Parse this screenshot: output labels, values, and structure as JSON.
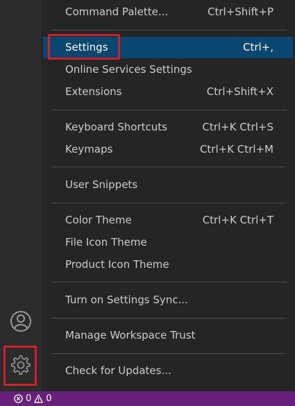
{
  "menu": {
    "items": [
      {
        "label": "Command Palette...",
        "shortcut": "Ctrl+Shift+P"
      },
      {
        "label": "Settings",
        "shortcut": "Ctrl+,"
      },
      {
        "label": "Online Services Settings",
        "shortcut": ""
      },
      {
        "label": "Extensions",
        "shortcut": "Ctrl+Shift+X"
      },
      {
        "label": "Keyboard Shortcuts",
        "shortcut": "Ctrl+K Ctrl+S"
      },
      {
        "label": "Keymaps",
        "shortcut": "Ctrl+K Ctrl+M"
      },
      {
        "label": "User Snippets",
        "shortcut": ""
      },
      {
        "label": "Color Theme",
        "shortcut": "Ctrl+K Ctrl+T"
      },
      {
        "label": "File Icon Theme",
        "shortcut": ""
      },
      {
        "label": "Product Icon Theme",
        "shortcut": ""
      },
      {
        "label": "Turn on Settings Sync...",
        "shortcut": ""
      },
      {
        "label": "Manage Workspace Trust",
        "shortcut": ""
      },
      {
        "label": "Check for Updates...",
        "shortcut": ""
      }
    ],
    "active_item": "Settings"
  },
  "activity_bar": {
    "icons": [
      "account-icon",
      "gear-icon"
    ]
  },
  "status_bar": {
    "errors": "0",
    "warnings": "0"
  },
  "colors": {
    "menu_bg": "#252526",
    "active_bg": "#094771",
    "highlight_border": "#d0202b",
    "status_bar_bg": "#68217a"
  }
}
